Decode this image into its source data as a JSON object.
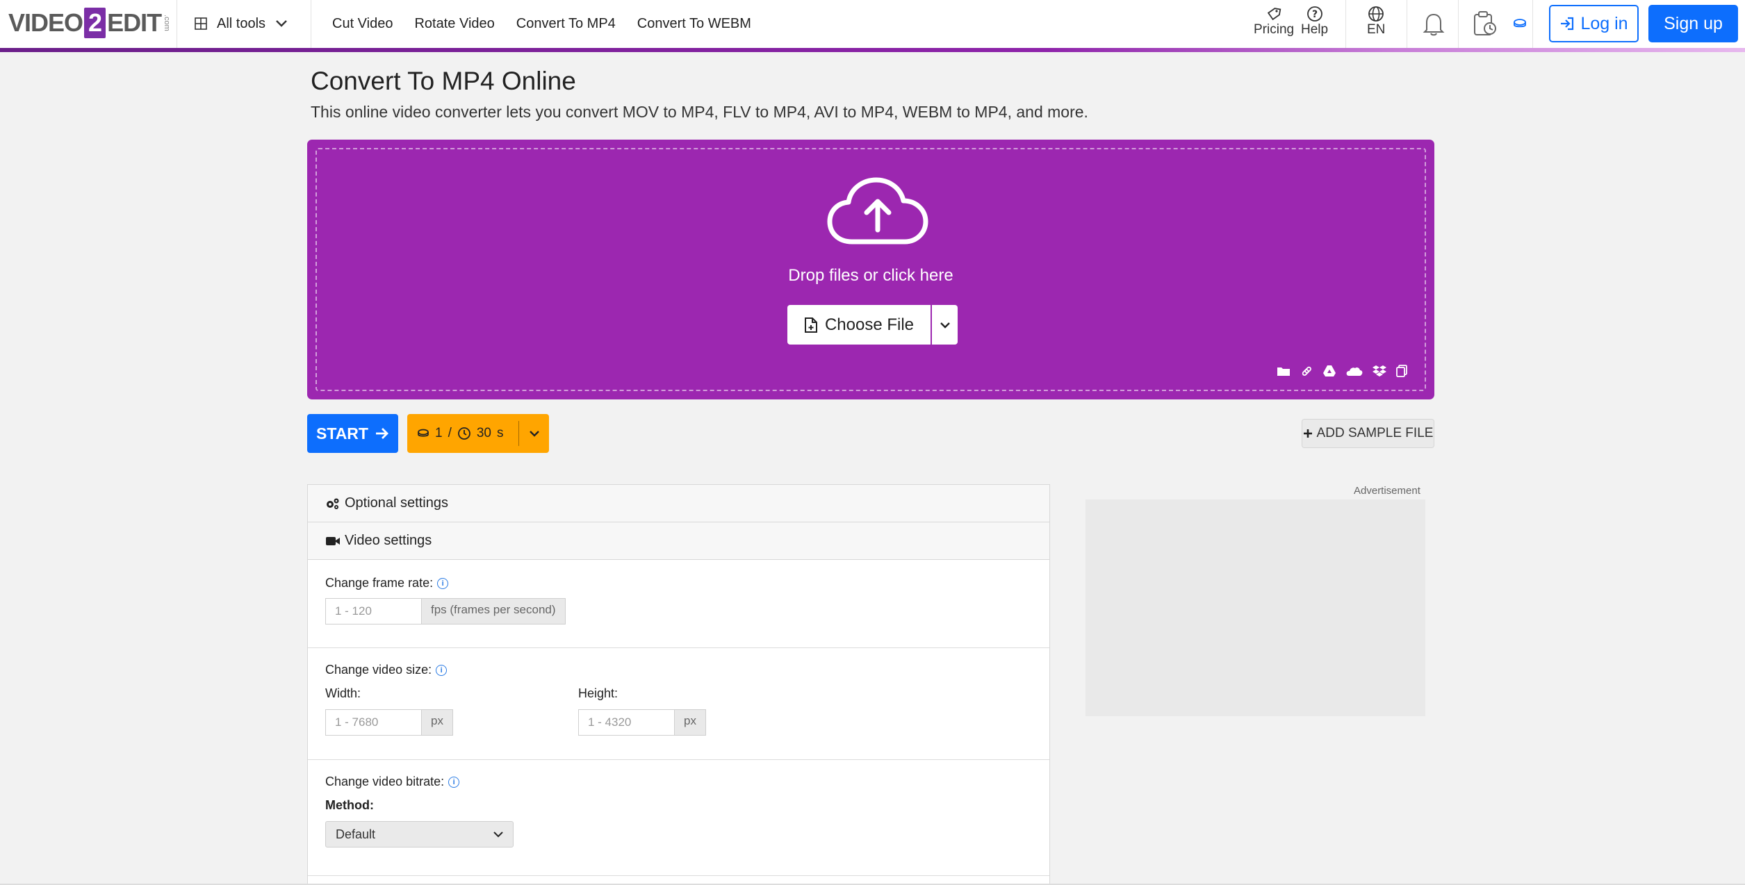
{
  "brand": {
    "logo_left": "VIDEO",
    "logo_num": "2",
    "logo_right": "EDIT",
    "logo_tld": ".com"
  },
  "nav": {
    "all_tools": "All tools",
    "links": [
      "Cut Video",
      "Rotate Video",
      "Convert To MP4",
      "Convert To WEBM"
    ],
    "pricing": "Pricing",
    "help": "Help",
    "language": "EN",
    "login": "Log in",
    "signup": "Sign up"
  },
  "page": {
    "title": "Convert To MP4 Online",
    "subtitle": "This online video converter lets you convert MOV to MP4, FLV to MP4, AVI to MP4, WEBM to MP4, and more."
  },
  "upload": {
    "drop_text": "Drop files or click here",
    "choose_file": "Choose File"
  },
  "actions": {
    "start": "START",
    "credits_count": "1",
    "credits_sep": "/",
    "credits_time": "30",
    "credits_unit": "s",
    "add_sample": "ADD SAMPLE FILE"
  },
  "settings": {
    "optional_title": "Optional settings",
    "video_title": "Video settings",
    "frame_rate": {
      "label": "Change frame rate:",
      "placeholder": "1 - 120",
      "unit": "fps (frames per second)"
    },
    "video_size": {
      "label": "Change video size:",
      "width_label": "Width:",
      "width_placeholder": "1 - 7680",
      "width_unit": "px",
      "height_label": "Height:",
      "height_placeholder": "1 - 4320",
      "height_unit": "px"
    },
    "bitrate": {
      "label": "Change video bitrate:",
      "method_label": "Method:",
      "method_value": "Default"
    }
  },
  "ad": {
    "label": "Advertisement"
  },
  "colors": {
    "accent_purple": "#9c27b0",
    "primary_blue": "#0d6efd",
    "credits_orange": "#ffa500"
  }
}
